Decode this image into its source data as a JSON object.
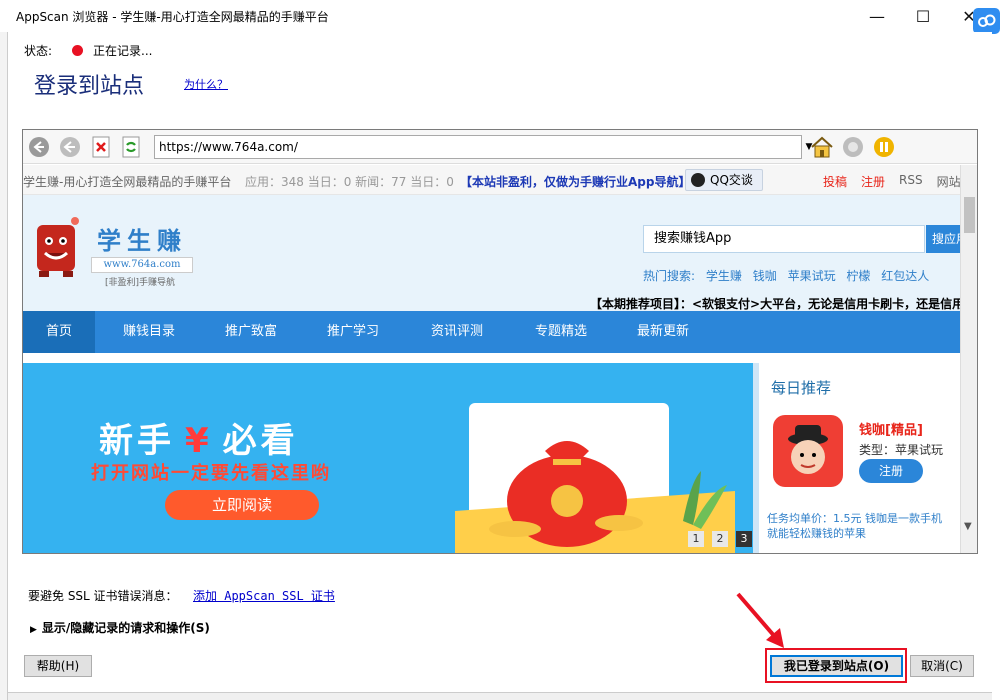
{
  "window": {
    "title": "AppScan 浏览器 - 学生赚-用心打造全网最精品的手赚平台",
    "min_label": "—",
    "max_label": "☐",
    "close_label": "✕"
  },
  "dialog": {
    "status_label": "状态:",
    "status_text": "正在记录...",
    "heading": "登录到站点",
    "why_link": "为什么？"
  },
  "browser": {
    "url": "https://www.764a.com/",
    "icons": [
      "back-icon",
      "forward-icon",
      "stop-icon",
      "refresh-icon",
      "home-icon",
      "record-icon",
      "pause-icon"
    ]
  },
  "web": {
    "infobar": {
      "site_name": "学生赚-用心打造全网最精品的手赚平台",
      "stats": "应用：348 当日：0 新闻：77 当日：0",
      "notice": "【本站非盈利，仅做为手赚行业App导航】",
      "qq_button": "QQ交谈",
      "links": [
        "投稿",
        "注册",
        "RSS",
        "网站"
      ]
    },
    "header": {
      "logo_text": "学生赚",
      "logo_url": "www.764a.com",
      "logo_tag": "[非盈利]手赚导航",
      "search_placeholder": "搜索赚钱App",
      "search_button": "搜应用",
      "hot_label": "热门搜索:",
      "hot_items": [
        "学生赚",
        "钱咖",
        "苹果试玩",
        "柠檬",
        "红包达人"
      ],
      "promo": "【本期推荐项目】：<软银支付>大平台，无论是信用卡刷卡，还是信用"
    },
    "nav": [
      "首页",
      "赚钱目录",
      "推广致富",
      "推广学习",
      "资讯评测",
      "专题精选",
      "最新更新"
    ],
    "banner": {
      "title_left": "新手",
      "title_mid": "¥",
      "title_right": "必看",
      "subtitle": "打开网站一定要先看这里哟",
      "button": "立即阅读",
      "pages": [
        "1",
        "2",
        "3"
      ],
      "active_page": "3"
    },
    "daily": {
      "title": "每日推荐",
      "app_name": "钱咖[精品]",
      "app_type": "类型：苹果试玩",
      "register": "注册",
      "desc_line1": "任务均单价：1.5元   钱咖是一款手机",
      "desc_line2": "就能轻松赚钱的苹果"
    }
  },
  "bottom": {
    "ssl_text": "要避免 SSL 证书错误消息：",
    "ssl_link": "添加 AppScan SSL 证书",
    "toggle": "显示/隐藏记录的请求和操作(S)",
    "help_button": "帮助(H)",
    "login_button": "我已登录到站点(O)",
    "cancel_button": "取消(C)"
  },
  "colors": {
    "accent_blue": "#2b86d9",
    "status_red": "#e81123",
    "heading_navy": "#1a2e7a",
    "highlight_red": "#e81123"
  }
}
